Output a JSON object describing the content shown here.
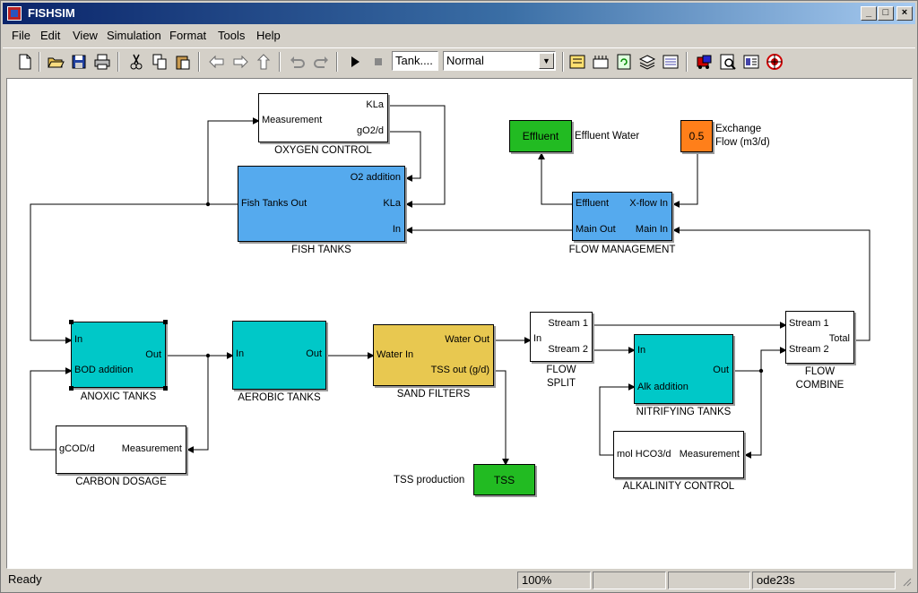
{
  "window": {
    "title": "FISHSIM"
  },
  "menu": [
    "File",
    "Edit",
    "View",
    "Simulation",
    "Format",
    "Tools",
    "Help"
  ],
  "toolbar": {
    "icons": [
      "new-file-icon",
      "open-folder-icon",
      "save-icon",
      "print-icon",
      "cut-icon",
      "copy-icon",
      "paste-icon",
      "back-arrow-icon",
      "forward-arrow-icon",
      "up-arrow-icon",
      "undo-icon",
      "redo-icon",
      "play-icon",
      "stop-icon"
    ],
    "stop_time": "Tank....",
    "sim_mode": "Normal",
    "right_icons": [
      "build-icon",
      "library-icon",
      "refresh-icon",
      "layers-icon",
      "model-browser-icon",
      "debug-icon",
      "profiler-icon",
      "explorer-icon",
      "target-icon"
    ]
  },
  "diagram": {
    "oxygen_control": {
      "label": "OXYGEN CONTROL",
      "in_measurement": "Measurement",
      "out_kla": "KLa",
      "out_go2": "gO2/d"
    },
    "fish_tanks": {
      "label": "FISH TANKS",
      "out_fish_tanks": "Fish Tanks Out",
      "in_o2": "O2 addition",
      "in_kla": "KLa",
      "in_in": "In"
    },
    "effluent": {
      "text": "Effluent",
      "annotation": "Effluent Water"
    },
    "exchange": {
      "value": "0.5",
      "annotation_line1": "Exchange",
      "annotation_line2": "Flow (m3/d)"
    },
    "flow_management": {
      "label": "FLOW MANAGEMENT",
      "out_effluent": "Effluent",
      "in_xflow": "X-flow In",
      "out_main": "Main Out",
      "in_main": "Main In"
    },
    "anoxic_tanks": {
      "label": "ANOXIC TANKS",
      "in_in": "In",
      "in_bod": "BOD addition",
      "out": "Out"
    },
    "aerobic_tanks": {
      "label": "AEROBIC TANKS",
      "in_in": "In",
      "out": "Out"
    },
    "sand_filters": {
      "label": "SAND FILTERS",
      "in_water": "Water In",
      "out_water": "Water Out",
      "out_tss": "TSS out (g/d)"
    },
    "flow_split": {
      "label_line1": "FLOW",
      "label_line2": "SPLIT",
      "in_in": "In",
      "out_stream1": "Stream 1",
      "out_stream2": "Stream 2"
    },
    "nitrifying_tanks": {
      "label": "NITRIFYING TANKS",
      "in_in": "In",
      "in_alk": "Alk addition",
      "out": "Out"
    },
    "flow_combine": {
      "label_line1": "FLOW",
      "label_line2": "COMBINE",
      "in_stream1": "Stream 1",
      "in_stream2": "Stream 2",
      "out_total": "Total"
    },
    "carbon_dosage": {
      "label": "CARBON DOSAGE",
      "out_gcod": "gCOD/d",
      "in_measurement": "Measurement"
    },
    "tss": {
      "text": "TSS",
      "annotation": "TSS production"
    },
    "alkalinity_control": {
      "label": "ALKALINITY CONTROL",
      "out_mol": "mol HCO3/d",
      "in_measurement": "Measurement"
    }
  },
  "colors": {
    "blue_block": "#55aaee",
    "cyan_block": "#00c8c8",
    "yellow_block": "#e8c850",
    "green_block": "#22bb22",
    "orange_block": "#ff7f1a"
  },
  "status": {
    "text": "Ready",
    "zoom": "100%",
    "solver": "ode23s"
  }
}
